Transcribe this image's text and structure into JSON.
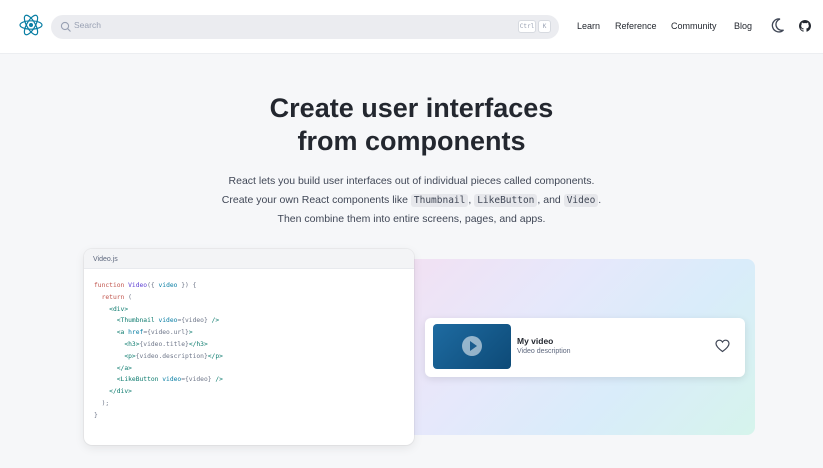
{
  "nav": {
    "search_placeholder": "Search",
    "kbd_ctrl": "Ctrl",
    "kbd_k": "K",
    "links": [
      "Learn",
      "Reference",
      "Community",
      "Blog"
    ]
  },
  "hero": {
    "title_line1": "Create user interfaces",
    "title_line2": "from components",
    "sub_line1": "React lets you build user interfaces out of individual pieces called components.",
    "sub_line2_a": "Create your own React components like ",
    "code1": "Thumbnail",
    "sep1": ", ",
    "code2": "LikeButton",
    "sep2": ", and ",
    "code3": "Video",
    "sep3": ".",
    "sub_line3": "Then combine them into entire screens, pages, and apps."
  },
  "code": {
    "filename": "Video.js"
  },
  "preview": {
    "video_title": "My video",
    "video_description": "Video description"
  },
  "colors": {
    "accent": "#087ea4",
    "text": "#23272f"
  }
}
